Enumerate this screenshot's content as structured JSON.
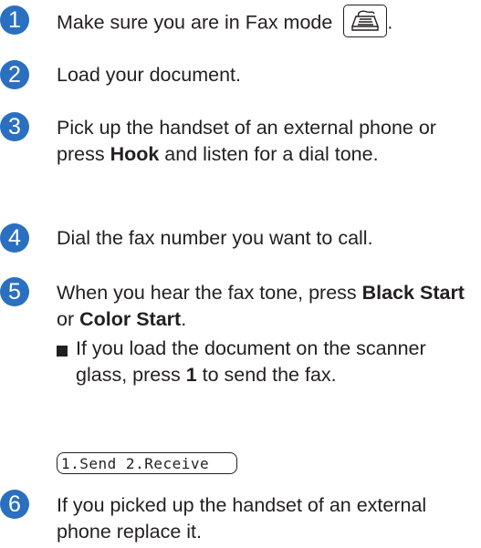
{
  "steps": [
    {
      "number": "1",
      "text": "Make sure you are in Fax mode",
      "suffix": "."
    },
    {
      "number": "2",
      "text": "Load your document."
    },
    {
      "number": "3",
      "text_before": "Pick up the handset of an external phone or press ",
      "bold": "Hook",
      "text_after": " and listen for a dial tone."
    },
    {
      "number": "4",
      "text": "Dial the fax number you want to call."
    },
    {
      "number": "5",
      "text_before": "When you hear the fax tone, press ",
      "bold1": "Black Start",
      "text_mid": " or ",
      "bold2": "Color Start",
      "text_after": ".",
      "sub": {
        "text_before": "If you load the document on the scanner glass, press ",
        "bold": "1",
        "text_after": " to send the fax."
      }
    },
    {
      "number": "6",
      "text": "If you picked up the handset of an external phone replace it."
    }
  ],
  "lcd_display": "1.Send 2.Receive",
  "icons": {
    "fax_mode": "fax-machine-icon",
    "bullet": "square-bullet-icon"
  },
  "colors": {
    "step_circle": "#2b6fc0",
    "text": "#231f20"
  }
}
